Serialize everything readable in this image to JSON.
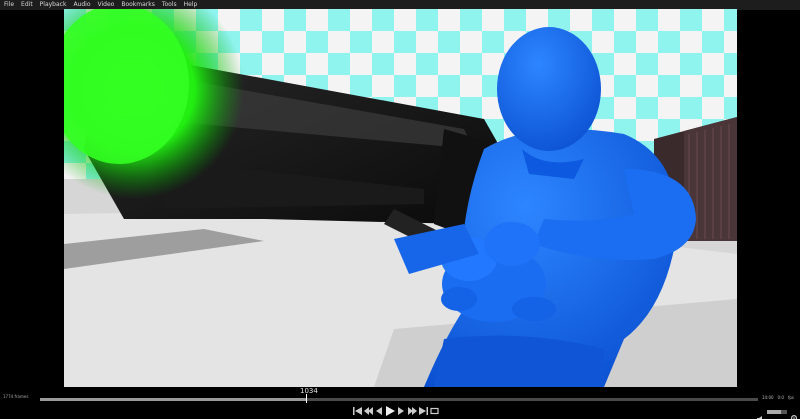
{
  "menu": {
    "items": [
      "File",
      "Edit",
      "Playback",
      "Audio",
      "Video",
      "Bookmarks",
      "Tools",
      "Help"
    ]
  },
  "timeline": {
    "current_frame": "1034",
    "left_status": "1774 frames",
    "right_status_1": "14:00",
    "right_status_2": "0:0",
    "right_status_3": "fps",
    "progress": 0.37
  },
  "transport": {
    "buttons": [
      "first-frame-icon",
      "prev-keyframe-icon",
      "prev-frame-icon",
      "play-icon",
      "next-frame-icon",
      "next-keyframe-icon",
      "last-frame-icon",
      "loop-icon"
    ]
  },
  "volume": {
    "level": 0.7,
    "label": "100%"
  },
  "colors": {
    "figure_blue": "#1769f0",
    "muzzle_green": "#22ff22",
    "sky_cyan": "#8ff3ee",
    "menubar_bg": "#1d1d1d"
  }
}
